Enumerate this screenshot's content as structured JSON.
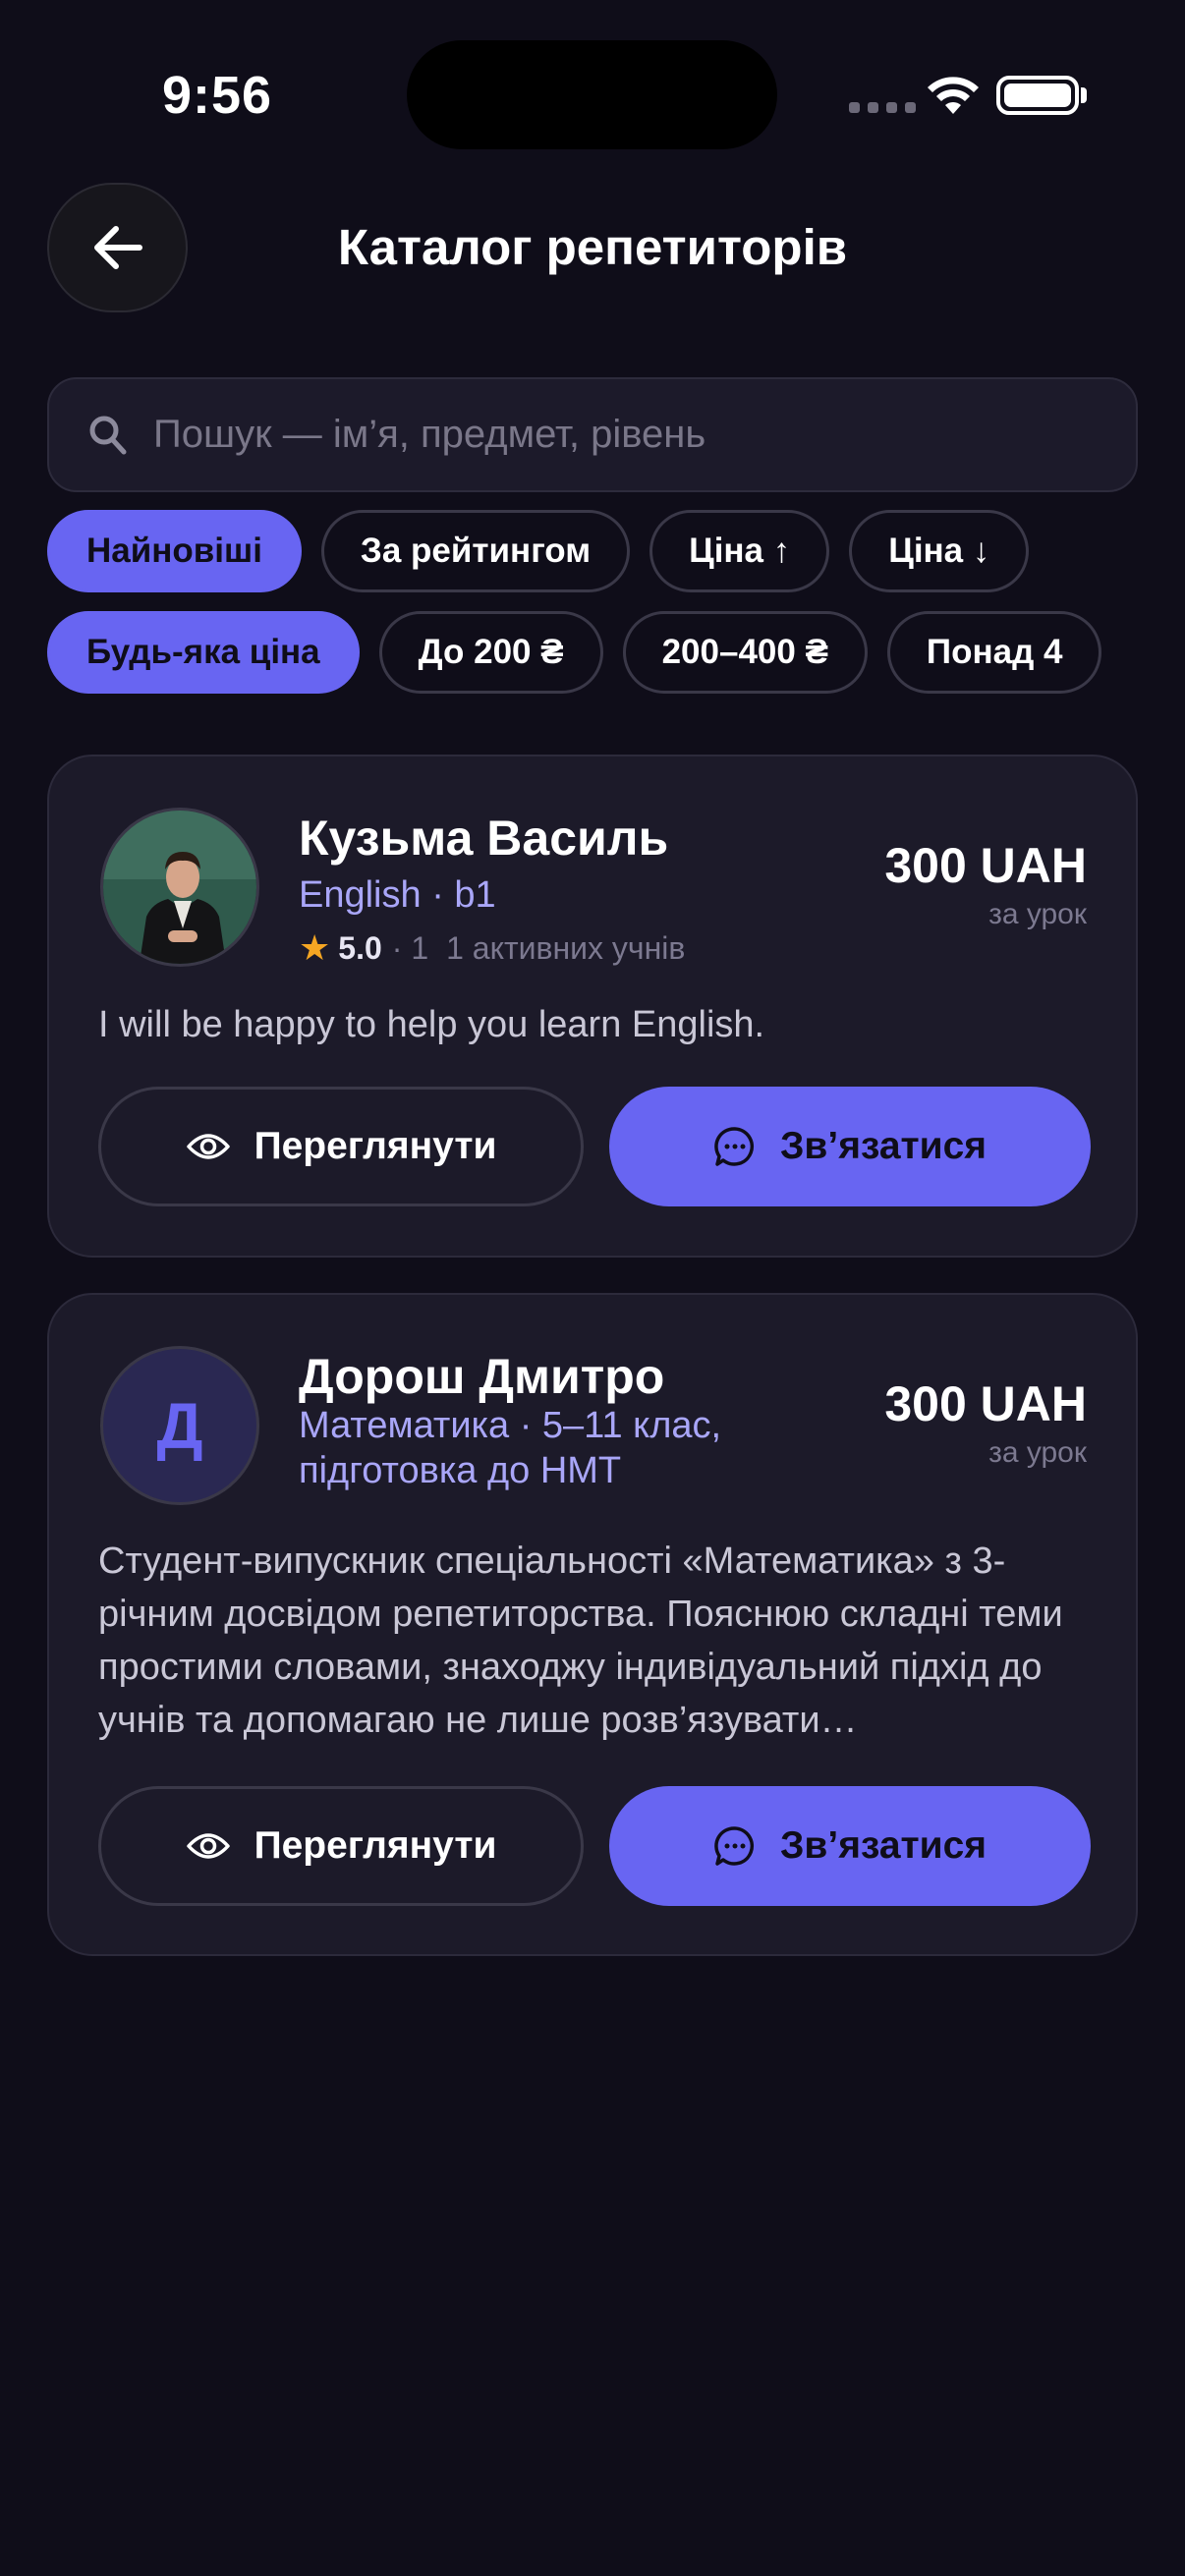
{
  "status_bar": {
    "time": "9:56"
  },
  "header": {
    "title": "Каталог репетиторів"
  },
  "search": {
    "placeholder": "Пошук — ім’я, предмет, рівень",
    "value": ""
  },
  "sort_chips": [
    {
      "label": "Найновіші",
      "active": true
    },
    {
      "label": "За рейтингом",
      "active": false
    },
    {
      "label": "Ціна ↑",
      "active": false
    },
    {
      "label": "Ціна ↓",
      "active": false
    }
  ],
  "price_chips": [
    {
      "label": "Будь-яка ціна",
      "active": true
    },
    {
      "label": "До 200 ₴",
      "active": false
    },
    {
      "label": "200–400 ₴",
      "active": false
    },
    {
      "label": "Понад 4",
      "active": false
    }
  ],
  "tutors": [
    {
      "name": "Кузьма Василь",
      "subject": "English · b1",
      "rating": "5.0",
      "reviews": "· 1",
      "students": "1 активних учнів",
      "price": "300 UAH",
      "price_unit": "за урок",
      "bio": "I will be happy to help you learn English.",
      "view_label": "Переглянути",
      "contact_label": "Зв’язатися"
    },
    {
      "name": "Дорош Дмитро",
      "avatar_letter": "Д",
      "subject": "Математика · 5–11 клас, підготовка до НМТ",
      "price": "300 UAH",
      "price_unit": "за урок",
      "bio": "Студент-випускник спеціальності «Математика» з 3-річним досвідом репетиторства. Пояснюю складні теми простими словами, знаходжу індивідуальний підхід до учнів та допомагаю не лише розв’язувати…",
      "view_label": "Переглянути",
      "contact_label": "Зв’язатися"
    }
  ],
  "colors": {
    "accent": "#6865f2",
    "background": "#0f0d19",
    "card": "#1c1a29",
    "star": "#f5a623"
  }
}
